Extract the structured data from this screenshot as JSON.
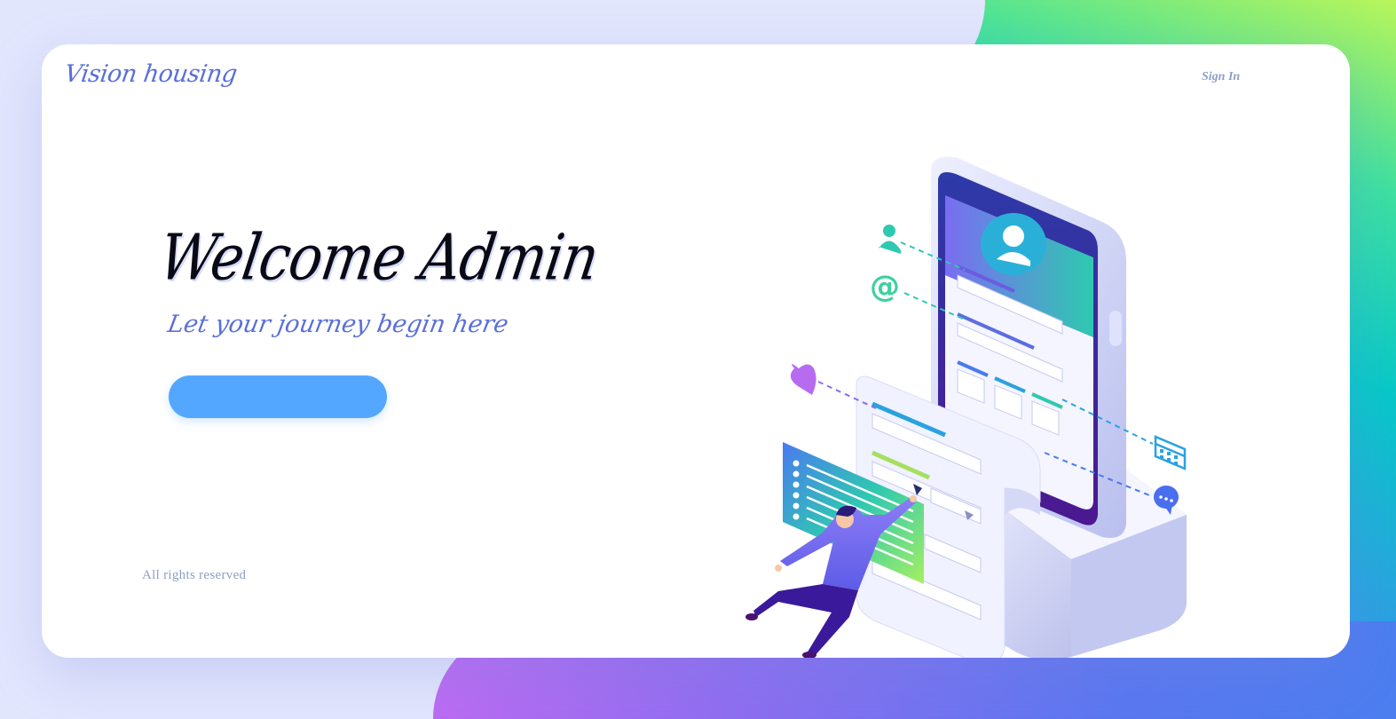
{
  "header": {
    "logo_text": "Vision housing",
    "signin_label": "Sign In"
  },
  "hero": {
    "title": "Welcome Admin",
    "subtitle": "Let your journey begin here",
    "cta_label": ""
  },
  "footer": {
    "text": "All rights reserved"
  },
  "illustration": {
    "icons": [
      "user-icon",
      "at-icon",
      "heart-icon",
      "calendar-icon",
      "chat-icon",
      "avatar-icon"
    ]
  },
  "colors": {
    "page_bg": "#e2e6fd",
    "accent_blue": "#53a7ff",
    "brand_text": "#5a6fd8",
    "muted_text": "#8e9fc4"
  }
}
